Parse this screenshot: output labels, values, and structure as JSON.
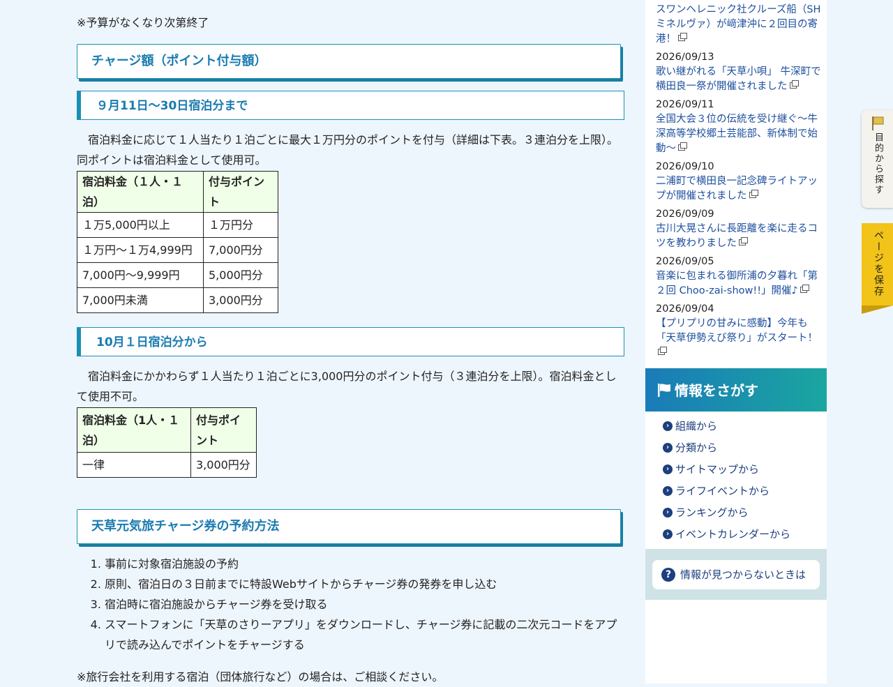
{
  "main": {
    "note_top": "※予算がなくなり次第終了",
    "h2_charge": "チャージ額（ポイント付与額）",
    "h3_sep": "９月11日〜30日宿泊分まで",
    "para_sep": "　宿泊料金に応じて１人当たり１泊ごとに最大１万円分のポイントを付与（詳細は下表。３連泊分を上限）。同ポイントは宿泊料金として使用可。",
    "table_sep": {
      "headers": [
        "宿泊料金（１人・１泊）",
        "付与ポイント"
      ],
      "rows": [
        [
          "１万5,000円以上",
          "１万円分"
        ],
        [
          "１万円〜１万4,999円",
          "7,000円分"
        ],
        [
          "7,000円〜9,999円",
          "5,000円分"
        ],
        [
          "7,000円未満",
          "3,000円分"
        ]
      ]
    },
    "h3_oct": "10月１日宿泊分から",
    "para_oct": "　宿泊料金にかかわらず１人当たり１泊ごとに3,000円分のポイント付与（３連泊分を上限）。宿泊料金として使用不可。",
    "table_oct": {
      "headers": [
        "宿泊料金（1人・１泊）",
        "付与ポイント"
      ],
      "rows": [
        [
          "一律",
          "3,000円分"
        ]
      ]
    },
    "h2_reserve": "天草元気旅チャージ券の予約方法",
    "steps": [
      "事前に対象宿泊施設の予約",
      "原則、宿泊日の３日前までに特設Webサイトからチャージ券の発券を申し込む",
      "宿泊時に宿泊施設からチャージ券を受け取る",
      "スマートフォンに「天草のさりーアプリ」をダウンロードし、チャージ券に記載の二次元コードをアプリで読み込んでポイントをチャージする"
    ],
    "note_bottom": "※旅行会社を利用する宿泊（団体旅行など）の場合は、ご相談ください。"
  },
  "sidebar": {
    "news": [
      {
        "date": "",
        "title": "スワンヘレニック社クルーズ船（SHミネルヴァ）が﨑津沖に２回目の寄港！"
      },
      {
        "date": "2026/09/13",
        "title": "歌い継がれる「天草小唄」 牛深町で横田良一祭が開催されました"
      },
      {
        "date": "2026/09/11",
        "title": "全国大会３位の伝統を受け継ぐ〜牛深高等学校郷土芸能部、新体制で始動〜"
      },
      {
        "date": "2026/09/10",
        "title": "二浦町で横田良一記念碑ライトアップが開催されました"
      },
      {
        "date": "2026/09/09",
        "title": "古川大晃さんに長距離を楽に走るコツを教わりました"
      },
      {
        "date": "2026/09/05",
        "title": "音楽に包まれる御所浦の夕暮れ「第２回 Choo-zai-show!!」開催♪"
      },
      {
        "date": "2026/09/04",
        "title": "【プリプリの甘みに感動】今年も「天草伊勢えび祭り」がスタート！"
      }
    ],
    "search_title": "情報をさがす",
    "search_items": [
      "組織から",
      "分類から",
      "サイトマップから",
      "ライフイベントから",
      "ランキングから",
      "イベントカレンダーから"
    ],
    "not_found": "情報が見つからないときは"
  },
  "tabs": {
    "purpose": "目的から探す",
    "save": "ページを保存"
  },
  "colors": {
    "accent": "#1a7bb0",
    "link": "#1d4f9e",
    "save_tab": "#f2c318"
  }
}
